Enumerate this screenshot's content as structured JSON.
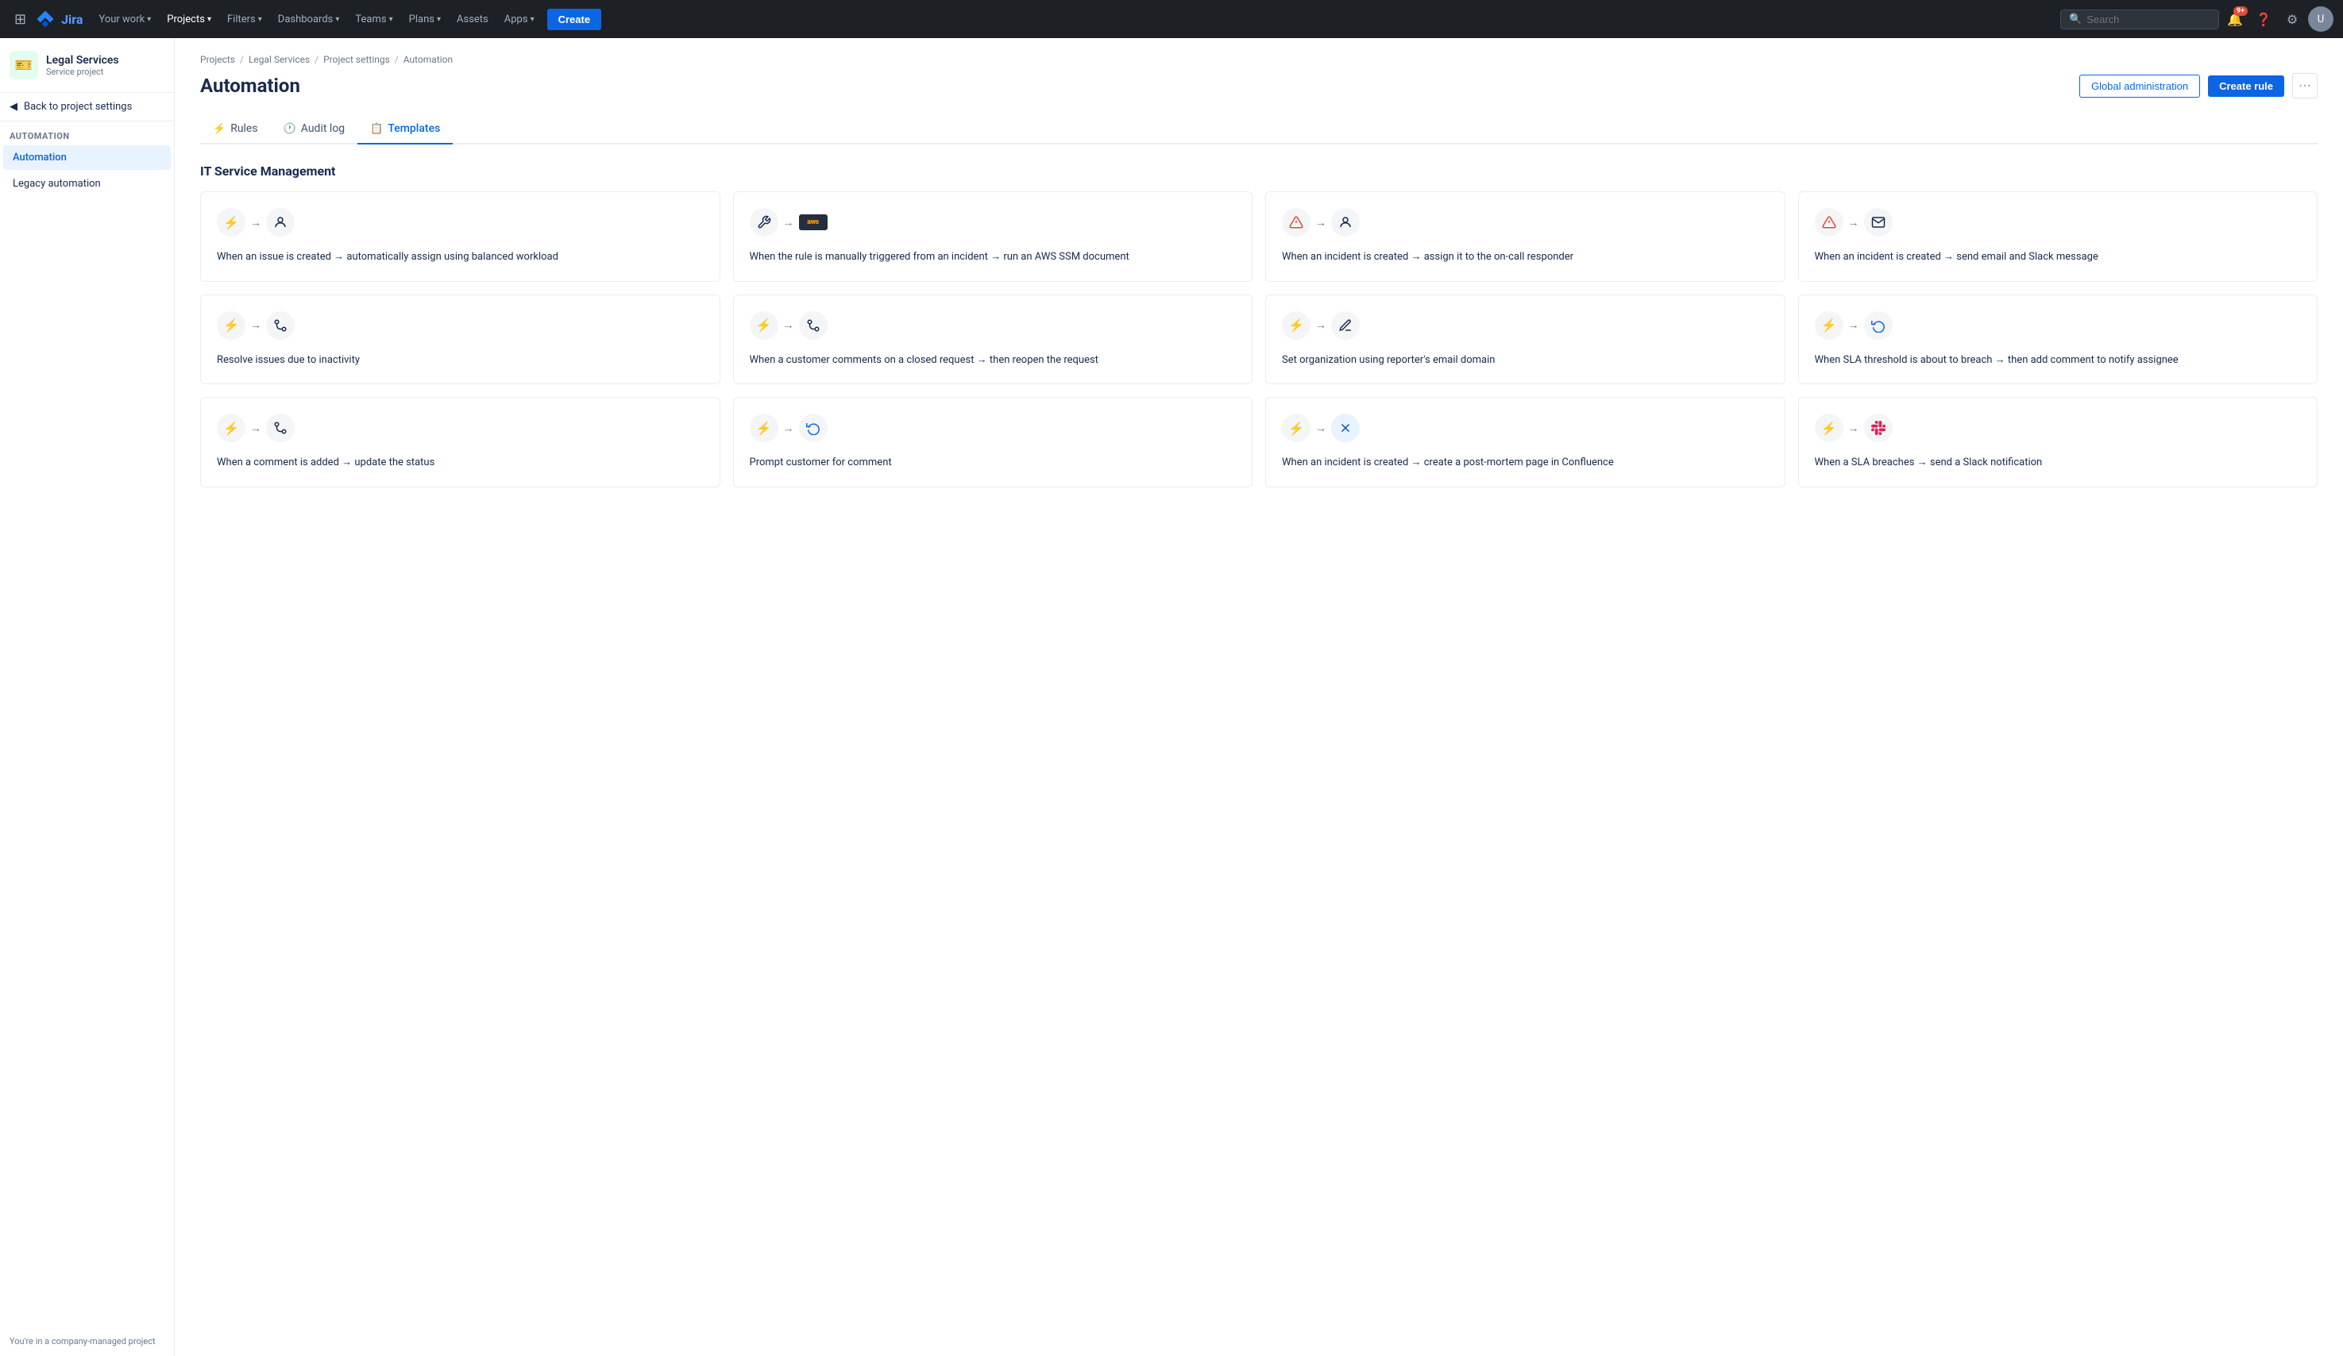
{
  "topnav": {
    "logo_text": "Jira",
    "your_work": "Your work",
    "projects": "Projects",
    "filters": "Filters",
    "dashboards": "Dashboards",
    "teams": "Teams",
    "plans": "Plans",
    "assets": "Assets",
    "apps": "Apps",
    "create_label": "Create",
    "search_placeholder": "Search",
    "notification_count": "9+"
  },
  "sidebar": {
    "project_name": "Legal Services",
    "project_type": "Service project",
    "back_label": "Back to project settings",
    "section_label": "AUTOMATION",
    "nav_items": [
      {
        "id": "automation",
        "label": "Automation",
        "active": true
      },
      {
        "id": "legacy-automation",
        "label": "Legacy automation",
        "active": false
      }
    ],
    "bottom_text": "You're in a company-managed project"
  },
  "breadcrumb": {
    "items": [
      "Projects",
      "Legal Services",
      "Project settings",
      "Automation"
    ]
  },
  "page": {
    "title": "Automation",
    "global_admin_label": "Global administration",
    "create_rule_label": "Create rule"
  },
  "tabs": [
    {
      "id": "rules",
      "label": "Rules",
      "icon": "⚡",
      "active": false
    },
    {
      "id": "audit-log",
      "label": "Audit log",
      "icon": "🕐",
      "active": false
    },
    {
      "id": "templates",
      "label": "Templates",
      "icon": "📋",
      "active": true
    }
  ],
  "sections": [
    {
      "title": "IT Service Management",
      "cards": [
        {
          "id": "card-1",
          "icon1": "⚡",
          "icon1_type": "blue",
          "icon2": "👤",
          "icon2_type": "dark",
          "text": "When an issue is created → automatically assign using balanced workload"
        },
        {
          "id": "card-2",
          "icon1": "🔧",
          "icon1_type": "dark",
          "icon2": "aws",
          "icon2_type": "aws",
          "text": "When the rule is manually triggered from an incident → run an AWS SSM document"
        },
        {
          "id": "card-3",
          "icon1": "⚠️",
          "icon1_type": "orange",
          "icon2": "👤",
          "icon2_type": "dark",
          "text": "When an incident is created → assign it to the on-call responder"
        },
        {
          "id": "card-4",
          "icon1": "⚠️",
          "icon1_type": "orange",
          "icon2": "✉️",
          "icon2_type": "dark",
          "text": "When an incident is created → send email and Slack message"
        },
        {
          "id": "card-5",
          "icon1": "⚡",
          "icon1_type": "blue",
          "icon2": "🔗",
          "icon2_type": "dark",
          "text": "Resolve issues due to inactivity"
        },
        {
          "id": "card-6",
          "icon1": "⚡",
          "icon1_type": "blue",
          "icon2": "🔗",
          "icon2_type": "dark",
          "text": "When a customer comments on a closed request → then reopen the request"
        },
        {
          "id": "card-7",
          "icon1": "⚡",
          "icon1_type": "blue",
          "icon2": "✏️",
          "icon2_type": "dark",
          "text": "Set organization using reporter's email domain"
        },
        {
          "id": "card-8",
          "icon1": "⚡",
          "icon1_type": "blue",
          "icon2": "🔄",
          "icon2_type": "blue",
          "text": "When SLA threshold is about to breach → then add comment to notify assignee"
        },
        {
          "id": "card-9",
          "icon1": "⚡",
          "icon1_type": "blue",
          "icon2": "🔗",
          "icon2_type": "dark",
          "text": "When a comment is added → update the status"
        },
        {
          "id": "card-10",
          "icon1": "⚡",
          "icon1_type": "blue",
          "icon2": "🔄",
          "icon2_type": "blue",
          "text": "Prompt customer for comment"
        },
        {
          "id": "card-11",
          "icon1": "⚡",
          "icon1_type": "blue",
          "icon2": "❌",
          "icon2_type": "dark",
          "text": "When an incident is created → create a post-mortem page in Confluence"
        },
        {
          "id": "card-12",
          "icon1": "⚡",
          "icon1_type": "blue",
          "icon2": "slack",
          "icon2_type": "slack",
          "text": "When a SLA breaches → send a Slack notification"
        }
      ]
    }
  ]
}
